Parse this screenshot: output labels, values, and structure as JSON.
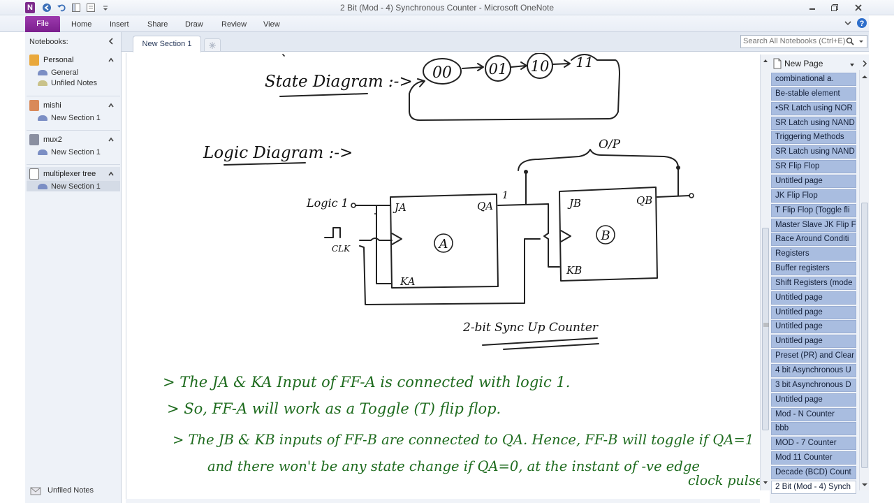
{
  "window": {
    "title": "2 Bit (Mod - 4) Synchronous Counter  -  Microsoft OneNote"
  },
  "ribbon": {
    "tabs": [
      "File",
      "Home",
      "Insert",
      "Share",
      "Draw",
      "Review",
      "View"
    ]
  },
  "nav": {
    "header": "Notebooks:",
    "notebooks": [
      {
        "name": "Personal",
        "color": "#e9a83c",
        "sections": [
          "General",
          "Unfiled Notes"
        ]
      },
      {
        "name": "mishi",
        "color": "#d98a5a",
        "sections": [
          "New Section 1"
        ]
      },
      {
        "name": "mux2",
        "color": "#8a8fa0",
        "sections": [
          "New Section 1"
        ]
      },
      {
        "name": "multiplexer tree",
        "color": "#9a9aa8",
        "sections": [
          "New Section 1"
        ]
      }
    ],
    "footer": "Unfiled Notes"
  },
  "section_tabs": {
    "active": "New Section 1"
  },
  "search": {
    "placeholder": "Search All Notebooks (Ctrl+E)"
  },
  "note": {
    "state_heading": "State Diagram :->",
    "states": [
      "00",
      "01",
      "10",
      "11"
    ],
    "logic_heading": "Logic Diagram :->",
    "labels": {
      "output": "O/P",
      "logic1": "Logic 1",
      "clk": "CLK",
      "ja": "JA",
      "ka": "KA",
      "qa": "QA",
      "jb": "JB",
      "kb": "KB",
      "qb": "QB",
      "ffa": "A",
      "ffb": "B",
      "one": "1",
      "caption": "2-bit Sync Up Counter"
    },
    "notes": [
      "> The JA & KA Input of FF-A is connected with logic 1.",
      "> So, FF-A will work as a Toggle (T) flip flop.",
      "> The JB & KB inputs of FF-B are connected to QA. Hence, FF-B will toggle if QA=1",
      "and there won't be any state change if QA=0, at the instant of -ve edge",
      "clock pulse."
    ]
  },
  "pages": {
    "new_page": "New Page",
    "items": [
      "combinational a.",
      "Be-stable element",
      "•SR Latch using NOR",
      "SR Latch using NAND",
      "Triggering Methods",
      "SR Latch using NAND",
      "SR Flip Flop",
      "Untitled page",
      "JK Flip Flop",
      "T Flip Flop (Toggle fli",
      "Master Slave JK Flip Fl",
      "Race Around Conditi",
      "Registers",
      "Buffer registers",
      "Shift Registers (mode",
      "Untitled page",
      "Untitled page",
      "Untitled page",
      "Untitled page",
      "Preset (PR) and Clear",
      "4 bit Asynchronous U",
      "3 bit Asynchronous D",
      "Untitled page",
      "Mod - N Counter",
      "bbb",
      "MOD - 7 Counter",
      "Mod 11 Counter",
      "Decade (BCD) Count",
      "2 Bit (Mod - 4) Synch"
    ]
  }
}
